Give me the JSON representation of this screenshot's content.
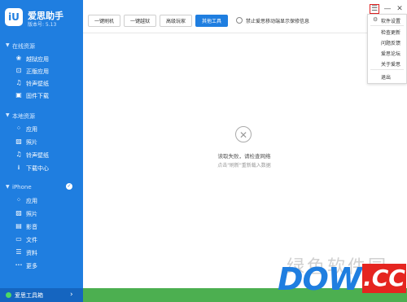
{
  "app": {
    "logo_text": "iU",
    "name": "爱思助手",
    "version": "版本号: 5.13"
  },
  "sidebar": {
    "sections": [
      {
        "title": "在线资源",
        "items": [
          {
            "icon": "❀",
            "label": "越狱应用"
          },
          {
            "icon": "⊡",
            "label": "正版应用"
          },
          {
            "icon": "♫",
            "label": "铃声壁纸"
          },
          {
            "icon": "▣",
            "label": "固件下载"
          }
        ]
      },
      {
        "title": "本地资源",
        "items": [
          {
            "icon": "⁘",
            "label": "应用"
          },
          {
            "icon": "▨",
            "label": "照片"
          },
          {
            "icon": "♫",
            "label": "铃声壁纸"
          },
          {
            "icon": "⭳",
            "label": "下载中心"
          }
        ]
      },
      {
        "title": "iPhone",
        "check": "✓",
        "items": [
          {
            "icon": "⁘",
            "label": "应用"
          },
          {
            "icon": "▨",
            "label": "照片"
          },
          {
            "icon": "▤",
            "label": "影音"
          },
          {
            "icon": "▭",
            "label": "文件"
          },
          {
            "icon": "☰",
            "label": "资料"
          },
          {
            "icon": "•••",
            "label": "更多"
          }
        ]
      }
    ],
    "bottom": {
      "label": "爱思工具箱",
      "arrow": "›"
    }
  },
  "toolbar": {
    "buttons": [
      "一键刷机",
      "一键越狱",
      "高级玩家",
      "其他工具"
    ],
    "active_index": 3,
    "radio_label": "禁止爱思移动端显示保修信息"
  },
  "window": {
    "menu": "☰",
    "minimize": "—",
    "close": "✕"
  },
  "menu_items": [
    "软件设置",
    "检查更新",
    "问题反馈",
    "爱思论坛",
    "关于爱思",
    "退出"
  ],
  "error": {
    "icon": "✕",
    "message": "读取失败，请检查网络",
    "hint": "点击\"刷新\"重新载入数据"
  },
  "watermark": {
    "brand": "DOWN",
    "suffix": ".CC",
    "chars": "绿色软件园"
  },
  "colors": {
    "sidebar": "#1f7ee0",
    "accent": "#1f7ee0",
    "highlight_box": "#e02020",
    "bottom_strip": "#4caf50"
  }
}
